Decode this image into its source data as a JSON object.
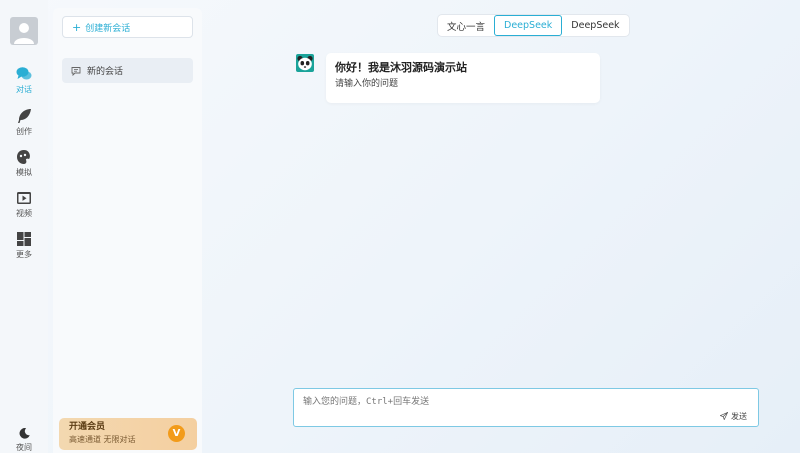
{
  "nav": {
    "items": [
      {
        "id": "chat",
        "label": "对话",
        "icon": "chat-bubbles-icon",
        "active": true
      },
      {
        "id": "create",
        "label": "创作",
        "icon": "feather-icon",
        "active": false
      },
      {
        "id": "simulate",
        "label": "模拟",
        "icon": "mask-icon",
        "active": false
      },
      {
        "id": "video",
        "label": "视频",
        "icon": "video-play-icon",
        "active": false
      },
      {
        "id": "more",
        "label": "更多",
        "icon": "grid-icon",
        "active": false
      }
    ],
    "night_label": "夜间",
    "accent": "#2aaed4"
  },
  "sidebar": {
    "new_chat_label": "创建新会话",
    "sessions": [
      {
        "title": "新的会话"
      }
    ],
    "vip": {
      "title": "开通会员",
      "subtitle": "高速通道 无限对话",
      "badge": "V"
    }
  },
  "model_tabs": [
    {
      "label": "文心一言",
      "active": false
    },
    {
      "label": "DeepSeek",
      "active": true
    },
    {
      "label": "DeepSeek",
      "active": false
    }
  ],
  "messages": [
    {
      "role": "assistant",
      "title": "你好！我是沐羽源码演示站",
      "text": "请输入你的问题"
    }
  ],
  "composer": {
    "placeholder": "输入您的问题，Ctrl+回车发送",
    "value": "",
    "send_label": "发送"
  }
}
